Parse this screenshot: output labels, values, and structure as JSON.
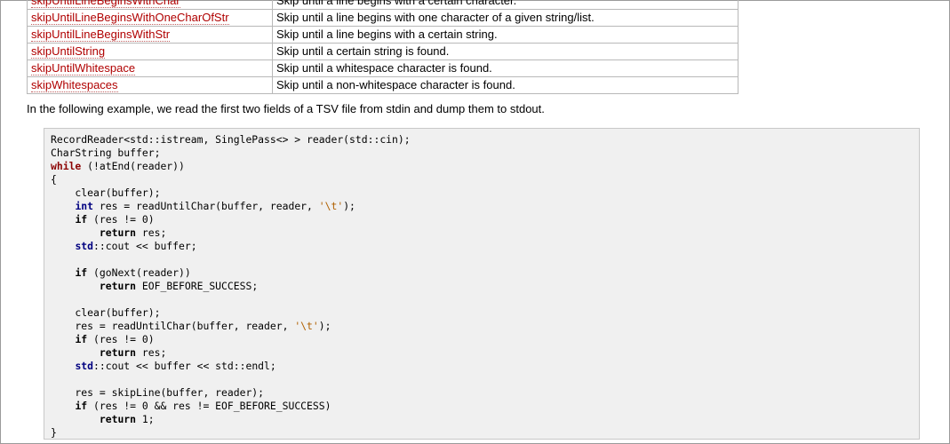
{
  "table": {
    "rows": [
      {
        "name": "skipUntilLineBeginsWithChar",
        "desc": "Skip until a line begins with a certain character."
      },
      {
        "name": "skipUntilLineBeginsWithOneCharOfStr",
        "desc": "Skip until a line begins with one character of a given string/list."
      },
      {
        "name": "skipUntilLineBeginsWithStr",
        "desc": "Skip until a line begins with a certain string."
      },
      {
        "name": "skipUntilString",
        "desc": "Skip until a certain string is found."
      },
      {
        "name": "skipUntilWhitespace",
        "desc": "Skip until a whitespace character is found."
      },
      {
        "name": "skipWhitespaces",
        "desc": "Skip until a non-whitespace character is found."
      }
    ]
  },
  "paragraph": "In the following example, we read the first two fields of a TSV file from stdin and dump them to stdout.",
  "code": [
    {
      "parts": [
        {
          "t": "RecordReader<std::istream, SinglePass<> > reader(std::cin);"
        }
      ]
    },
    {
      "parts": [
        {
          "t": "CharString buffer;"
        }
      ]
    },
    {
      "parts": [
        {
          "t": "while",
          "c": "kw"
        },
        {
          "t": " (!atEnd(reader))"
        }
      ]
    },
    {
      "parts": [
        {
          "t": "{"
        }
      ]
    },
    {
      "parts": [
        {
          "t": "    clear(buffer);"
        }
      ]
    },
    {
      "parts": [
        {
          "t": "    "
        },
        {
          "t": "int",
          "c": "kwb"
        },
        {
          "t": " res = readUntilChar(buffer, reader, "
        },
        {
          "t": "'\\t'",
          "c": "str"
        },
        {
          "t": ");"
        }
      ]
    },
    {
      "parts": [
        {
          "t": "    "
        },
        {
          "t": "if",
          "c": "ret"
        },
        {
          "t": " (res != 0)"
        }
      ]
    },
    {
      "parts": [
        {
          "t": "        "
        },
        {
          "t": "return",
          "c": "ret"
        },
        {
          "t": " res;"
        }
      ]
    },
    {
      "parts": [
        {
          "t": "    "
        },
        {
          "t": "std",
          "c": "kwb"
        },
        {
          "t": "::cout << buffer;"
        }
      ]
    },
    {
      "parts": [
        {
          "t": ""
        }
      ]
    },
    {
      "parts": [
        {
          "t": "    "
        },
        {
          "t": "if",
          "c": "ret"
        },
        {
          "t": " (goNext(reader))"
        }
      ]
    },
    {
      "parts": [
        {
          "t": "        "
        },
        {
          "t": "return",
          "c": "ret"
        },
        {
          "t": " EOF_BEFORE_SUCCESS;"
        }
      ]
    },
    {
      "parts": [
        {
          "t": ""
        }
      ]
    },
    {
      "parts": [
        {
          "t": "    clear(buffer);"
        }
      ]
    },
    {
      "parts": [
        {
          "t": "    res = readUntilChar(buffer, reader, "
        },
        {
          "t": "'\\t'",
          "c": "str"
        },
        {
          "t": ");"
        }
      ]
    },
    {
      "parts": [
        {
          "t": "    "
        },
        {
          "t": "if",
          "c": "ret"
        },
        {
          "t": " (res != 0)"
        }
      ]
    },
    {
      "parts": [
        {
          "t": "        "
        },
        {
          "t": "return",
          "c": "ret"
        },
        {
          "t": " res;"
        }
      ]
    },
    {
      "parts": [
        {
          "t": "    "
        },
        {
          "t": "std",
          "c": "kwb"
        },
        {
          "t": "::cout << buffer << std::endl;"
        }
      ]
    },
    {
      "parts": [
        {
          "t": ""
        }
      ]
    },
    {
      "parts": [
        {
          "t": "    res = skipLine(buffer, reader);"
        }
      ]
    },
    {
      "parts": [
        {
          "t": "    "
        },
        {
          "t": "if",
          "c": "ret"
        },
        {
          "t": " (res != 0 && res != EOF_BEFORE_SUCCESS)"
        }
      ]
    },
    {
      "parts": [
        {
          "t": "        "
        },
        {
          "t": "return",
          "c": "ret"
        },
        {
          "t": " 1;"
        }
      ]
    },
    {
      "parts": [
        {
          "t": "}"
        }
      ]
    }
  ]
}
